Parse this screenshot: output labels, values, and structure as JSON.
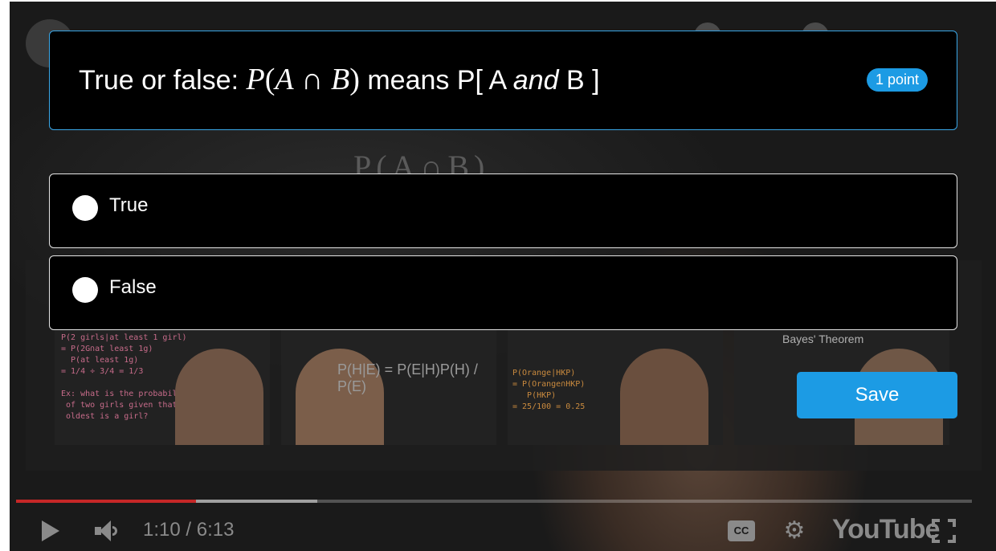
{
  "quiz": {
    "question": {
      "prefix": "True or false: ",
      "math_p": "P",
      "math_open": "(",
      "math_a": "A",
      "math_cap": " ∩ ",
      "math_b": "B",
      "math_close": ")",
      "middle": " means P[ A ",
      "emphasis": "and",
      "suffix": " B ]"
    },
    "points": "1 point",
    "options": [
      {
        "label": "True",
        "selected": false
      },
      {
        "label": "False",
        "selected": false
      }
    ],
    "save_label": "Save",
    "accent_color": "#1c9be4"
  },
  "video": {
    "board_text": "P(A∩B)",
    "suggestions": [
      {
        "formula": ""
      },
      {
        "formula": "P(H|E) = P(E|H)P(H) / P(E)"
      },
      {
        "formula": ""
      },
      {
        "formula": "Bayes' Theorem"
      }
    ]
  },
  "player": {
    "current_time": "1:10 / 6:13",
    "played_fraction": 0.188,
    "buffered_fraction": 0.315,
    "cc_label": "CC",
    "logo_text": "YouTube",
    "progress_color": "#c62727"
  }
}
